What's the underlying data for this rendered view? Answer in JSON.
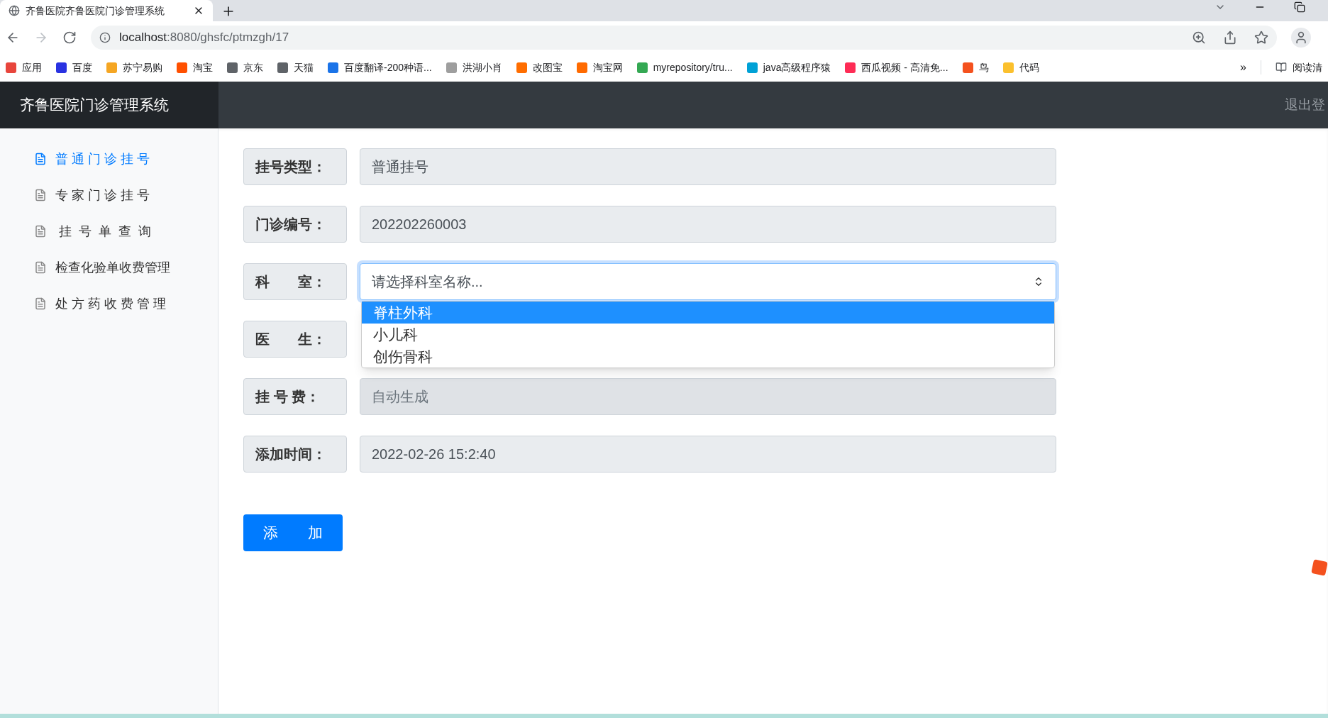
{
  "browser": {
    "tab_title": "齐鲁医院齐鲁医院门诊管理系统",
    "url_host": "localhost",
    "url_path": ":8080/ghsfc/ptmzgh/17"
  },
  "bookmarks": [
    {
      "label": "应用",
      "color": "#e8453c"
    },
    {
      "label": "百度",
      "color": "#2932e1"
    },
    {
      "label": "苏宁易购",
      "color": "#f5a623"
    },
    {
      "label": "淘宝",
      "color": "#ff5000"
    },
    {
      "label": "京东",
      "color": "#5f6368"
    },
    {
      "label": "天猫",
      "color": "#5f6368"
    },
    {
      "label": "百度翻译-200种语...",
      "color": "#1a73e8"
    },
    {
      "label": "洪湖小肖",
      "color": "#9e9e9e"
    },
    {
      "label": "改图宝",
      "color": "#ff6d00"
    },
    {
      "label": "淘宝网",
      "color": "#ff6a00"
    },
    {
      "label": "myrepository/tru...",
      "color": "#34a853"
    },
    {
      "label": "java高级程序猿",
      "color": "#00a1d6"
    },
    {
      "label": "西瓜视频 - 高清免...",
      "color": "#fe2c55"
    },
    {
      "label": "鸟",
      "color": "#f4511e"
    },
    {
      "label": "代码",
      "color": "#fbc02d"
    }
  ],
  "bookmarks_more": "»",
  "reading_list": "阅读清",
  "header": {
    "title": "齐鲁医院门诊管理系统",
    "logout": "退出登"
  },
  "sidebar": {
    "items": [
      {
        "label": "普 通 门 诊 挂 号",
        "selected": true
      },
      {
        "label": "专 家 门 诊 挂 号",
        "selected": false
      },
      {
        "label": " 挂  号  单  查  询",
        "selected": false
      },
      {
        "label": "检查化验单收费管理",
        "selected": false
      },
      {
        "label": "处 方 药 收 费 管 理",
        "selected": false
      }
    ]
  },
  "form": {
    "rows": [
      {
        "kind": "input",
        "label": "挂号类型：",
        "value": "普通挂号"
      },
      {
        "kind": "input",
        "label": "门诊编号：",
        "value": "202202260003"
      },
      {
        "kind": "select",
        "label": "科　　室：",
        "placeholder": "请选择科室名称...",
        "expanded": true,
        "options": [
          {
            "label": "脊柱外科",
            "selected": true
          },
          {
            "label": "小儿科",
            "selected": false
          },
          {
            "label": "创伤骨科",
            "selected": false
          }
        ]
      },
      {
        "kind": "hidden",
        "label": "医　　生："
      },
      {
        "kind": "input",
        "label": "挂 号 费：",
        "placeholder": "自动生成",
        "disabled": true
      },
      {
        "kind": "input",
        "label": "添加时间：",
        "value": "2022-02-26 15:2:40"
      }
    ],
    "submit": "添　　加"
  }
}
